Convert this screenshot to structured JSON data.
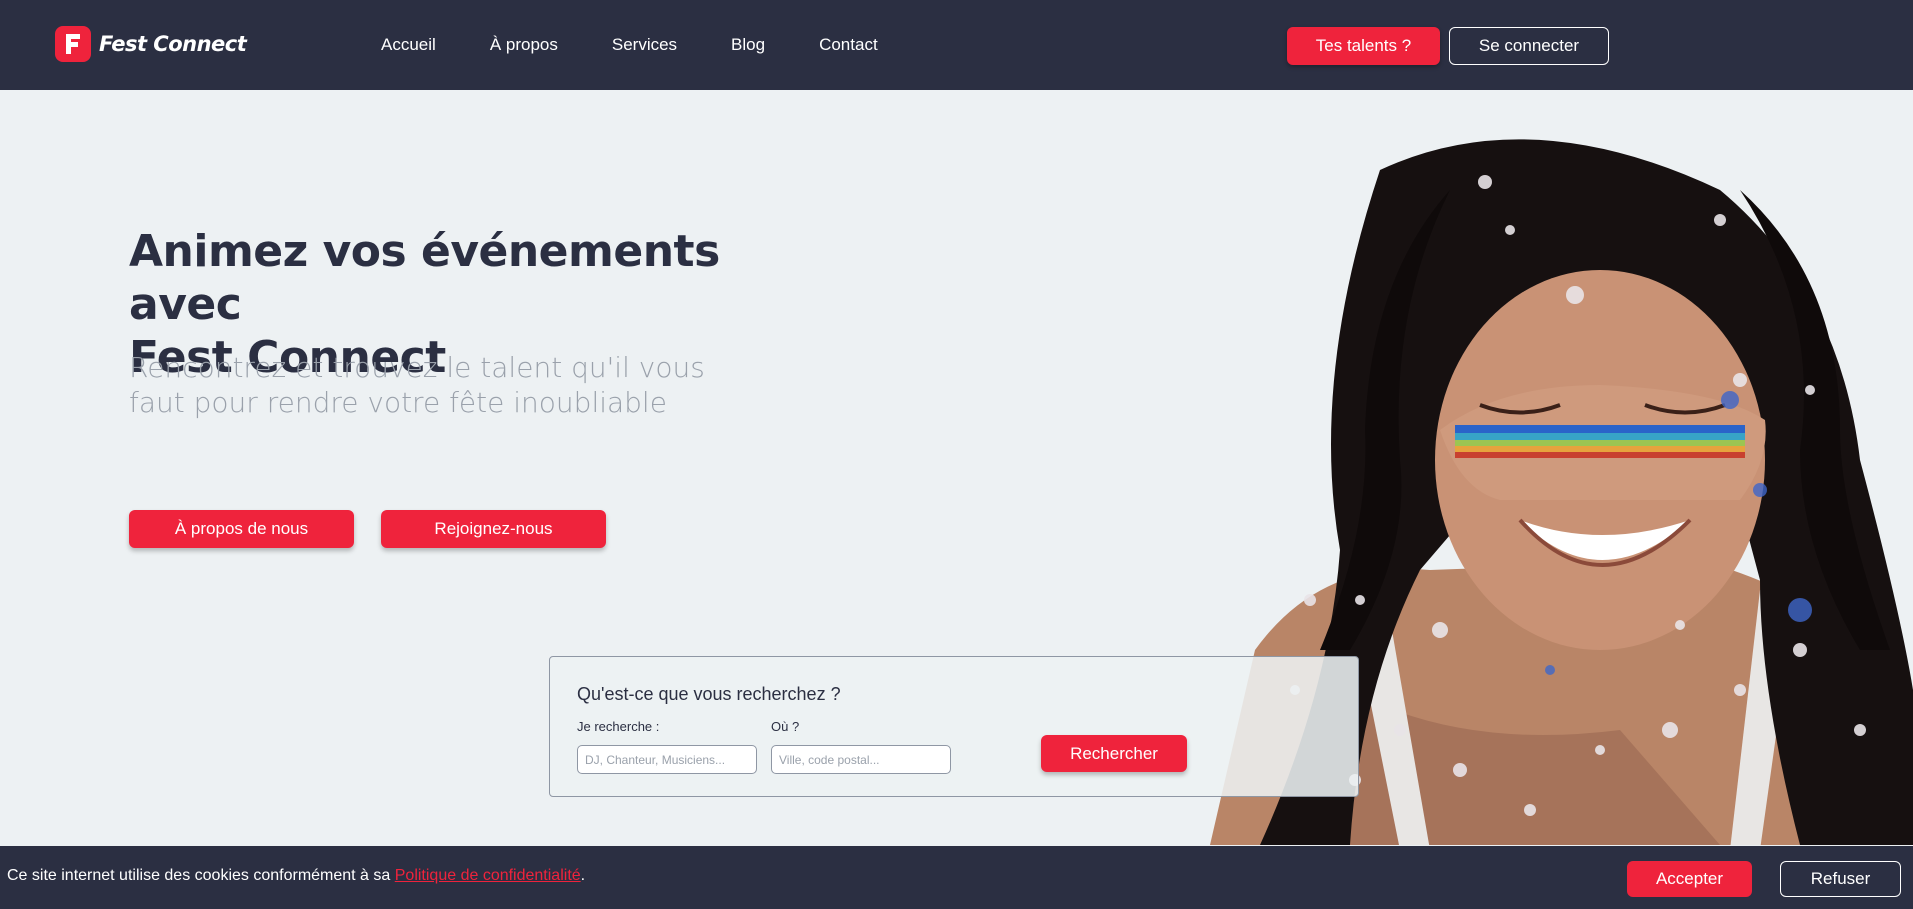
{
  "header": {
    "brand": "Fest Connect",
    "logo_letter": "F",
    "nav": [
      "Accueil",
      "À propos",
      "Services",
      "Blog",
      "Contact"
    ],
    "talents_button": "Tes talents ?",
    "login_button": "Se connecter"
  },
  "hero": {
    "title_line1": "Animez vos événements avec",
    "title_line2": "Fest Connect",
    "subtitle_line1": "Rencontrez et trouvez le talent qu'il vous",
    "subtitle_line2": "faut pour rendre votre fête inoubliable",
    "about_button": "À propos de nous",
    "join_button": "Rejoignez-nous"
  },
  "search": {
    "title": "Qu'est-ce que vous recherchez ?",
    "what_label": "Je recherche :",
    "what_placeholder": "DJ, Chanteur, Musiciens...",
    "where_label": "Où ?",
    "where_placeholder": "Ville, code postal...",
    "submit": "Rechercher"
  },
  "cookie": {
    "text": "Ce site internet utilise des cookies conformément à sa ",
    "link": "Politique de confidentialité",
    "suffix": ".",
    "accept": "Accepter",
    "refuse": "Refuser"
  },
  "colors": {
    "primary": "#ef233c",
    "dark": "#2b2f42",
    "background": "#edf1f3"
  }
}
